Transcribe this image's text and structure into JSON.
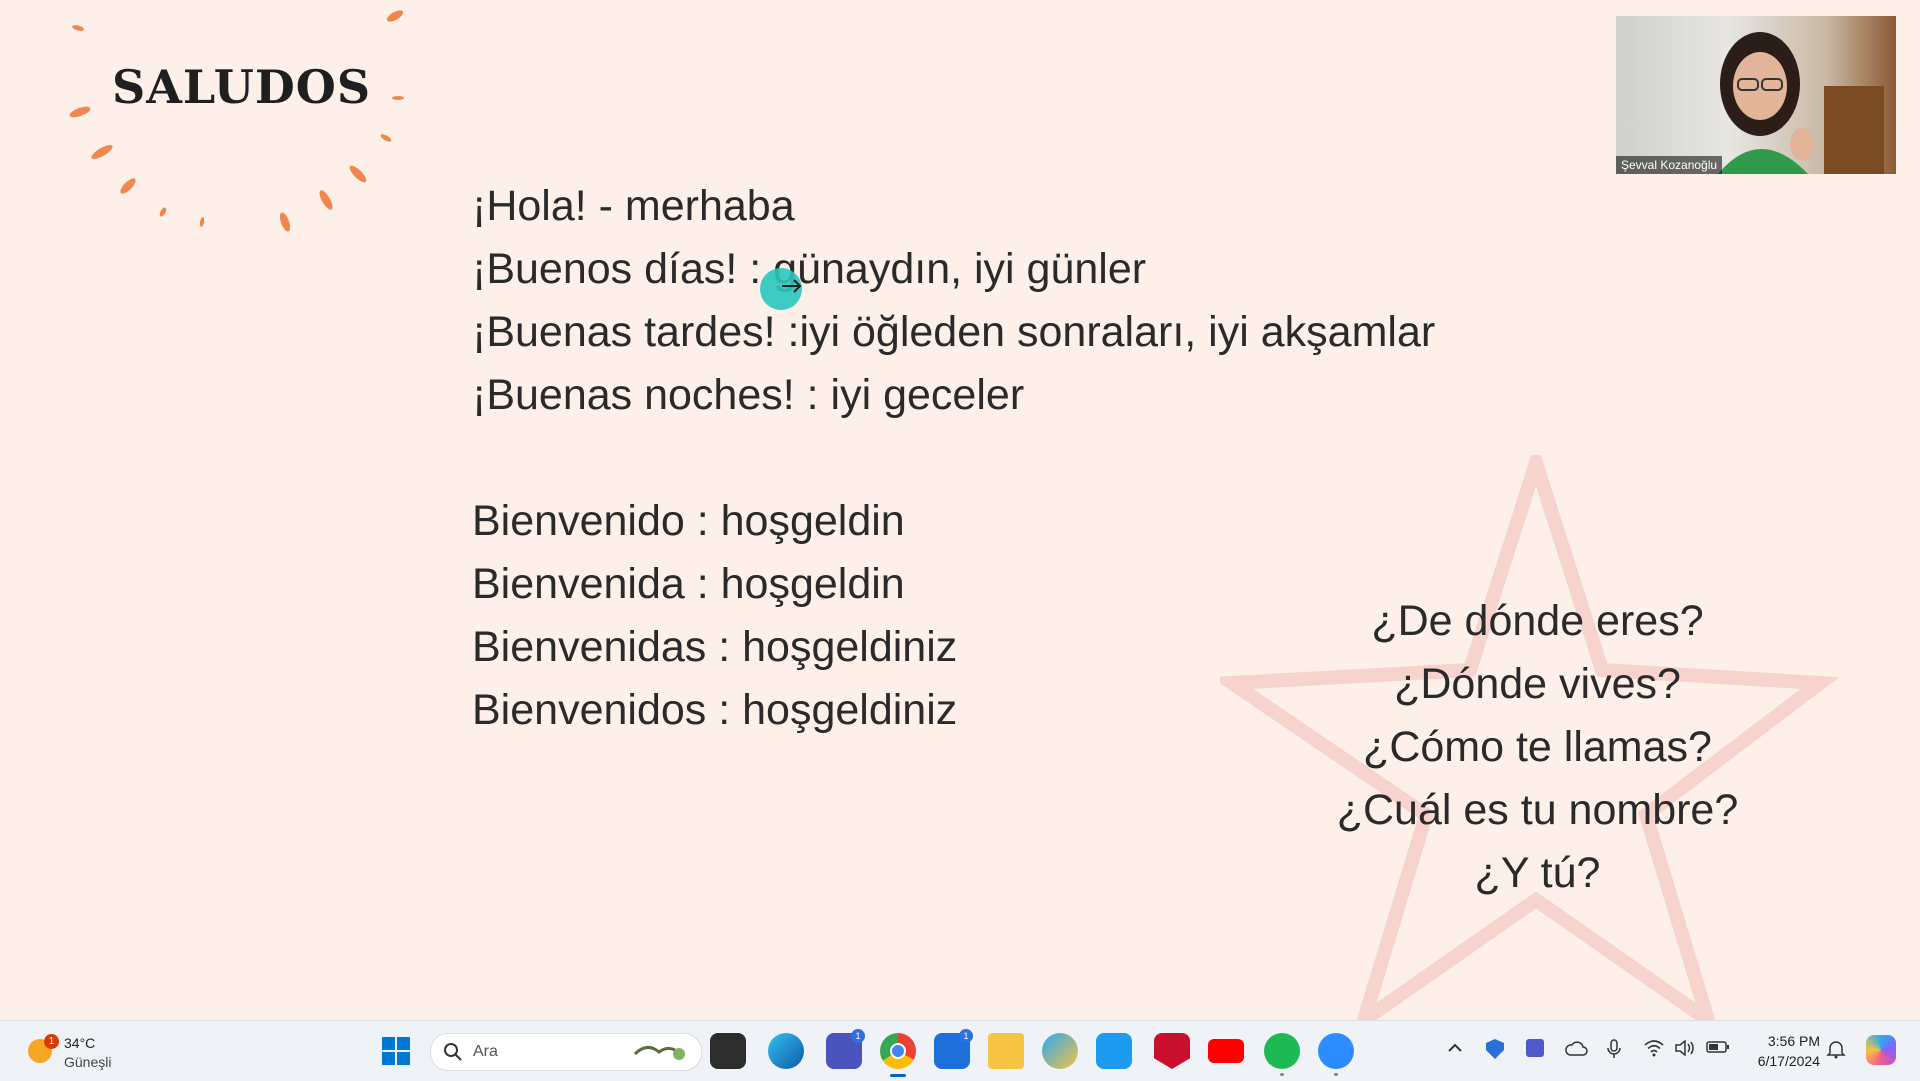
{
  "slide": {
    "title": "SALUDOS",
    "greetings": [
      "¡Hola! - merhaba",
      "¡Buenos días! : günaydın, iyi günler",
      "¡Buenas tardes! :iyi öğleden sonraları, iyi akşamlar",
      "¡Buenas noches! : iyi geceler"
    ],
    "welcome": [
      "Bienvenido : hoşgeldin",
      "Bienvenida : hoşgeldin",
      "Bienvenidas : hoşgeldiniz",
      "Bienvenidos : hoşgeldiniz"
    ],
    "questions": [
      "¿De dónde eres?",
      "¿Dónde vives?",
      "¿Cómo te llamas?",
      "¿Cuál es tu nombre?",
      "¿Y tú?"
    ],
    "colors": {
      "accent": "#f0874f",
      "star": "#f4c9c2",
      "cursor": "#29c6bd"
    }
  },
  "webcam": {
    "participant_name": "Şevval Kozanoğlu"
  },
  "taskbar": {
    "weather": {
      "temp": "34°C",
      "condition": "Güneşli",
      "badge": "1"
    },
    "search_placeholder": "Ara",
    "apps": [
      {
        "name": "file-explorer-icon"
      },
      {
        "name": "edge-icon"
      },
      {
        "name": "teams-icon",
        "badge": "1"
      },
      {
        "name": "chrome-icon"
      },
      {
        "name": "store-icon",
        "badge": "1"
      },
      {
        "name": "folder-icon"
      },
      {
        "name": "copilot-icon"
      },
      {
        "name": "twitter-icon"
      },
      {
        "name": "mcafee-icon"
      },
      {
        "name": "youtube-icon"
      },
      {
        "name": "spotify-icon"
      },
      {
        "name": "zoom-icon"
      }
    ],
    "clock": {
      "time": "3:56 PM",
      "date": "6/17/2024"
    }
  }
}
